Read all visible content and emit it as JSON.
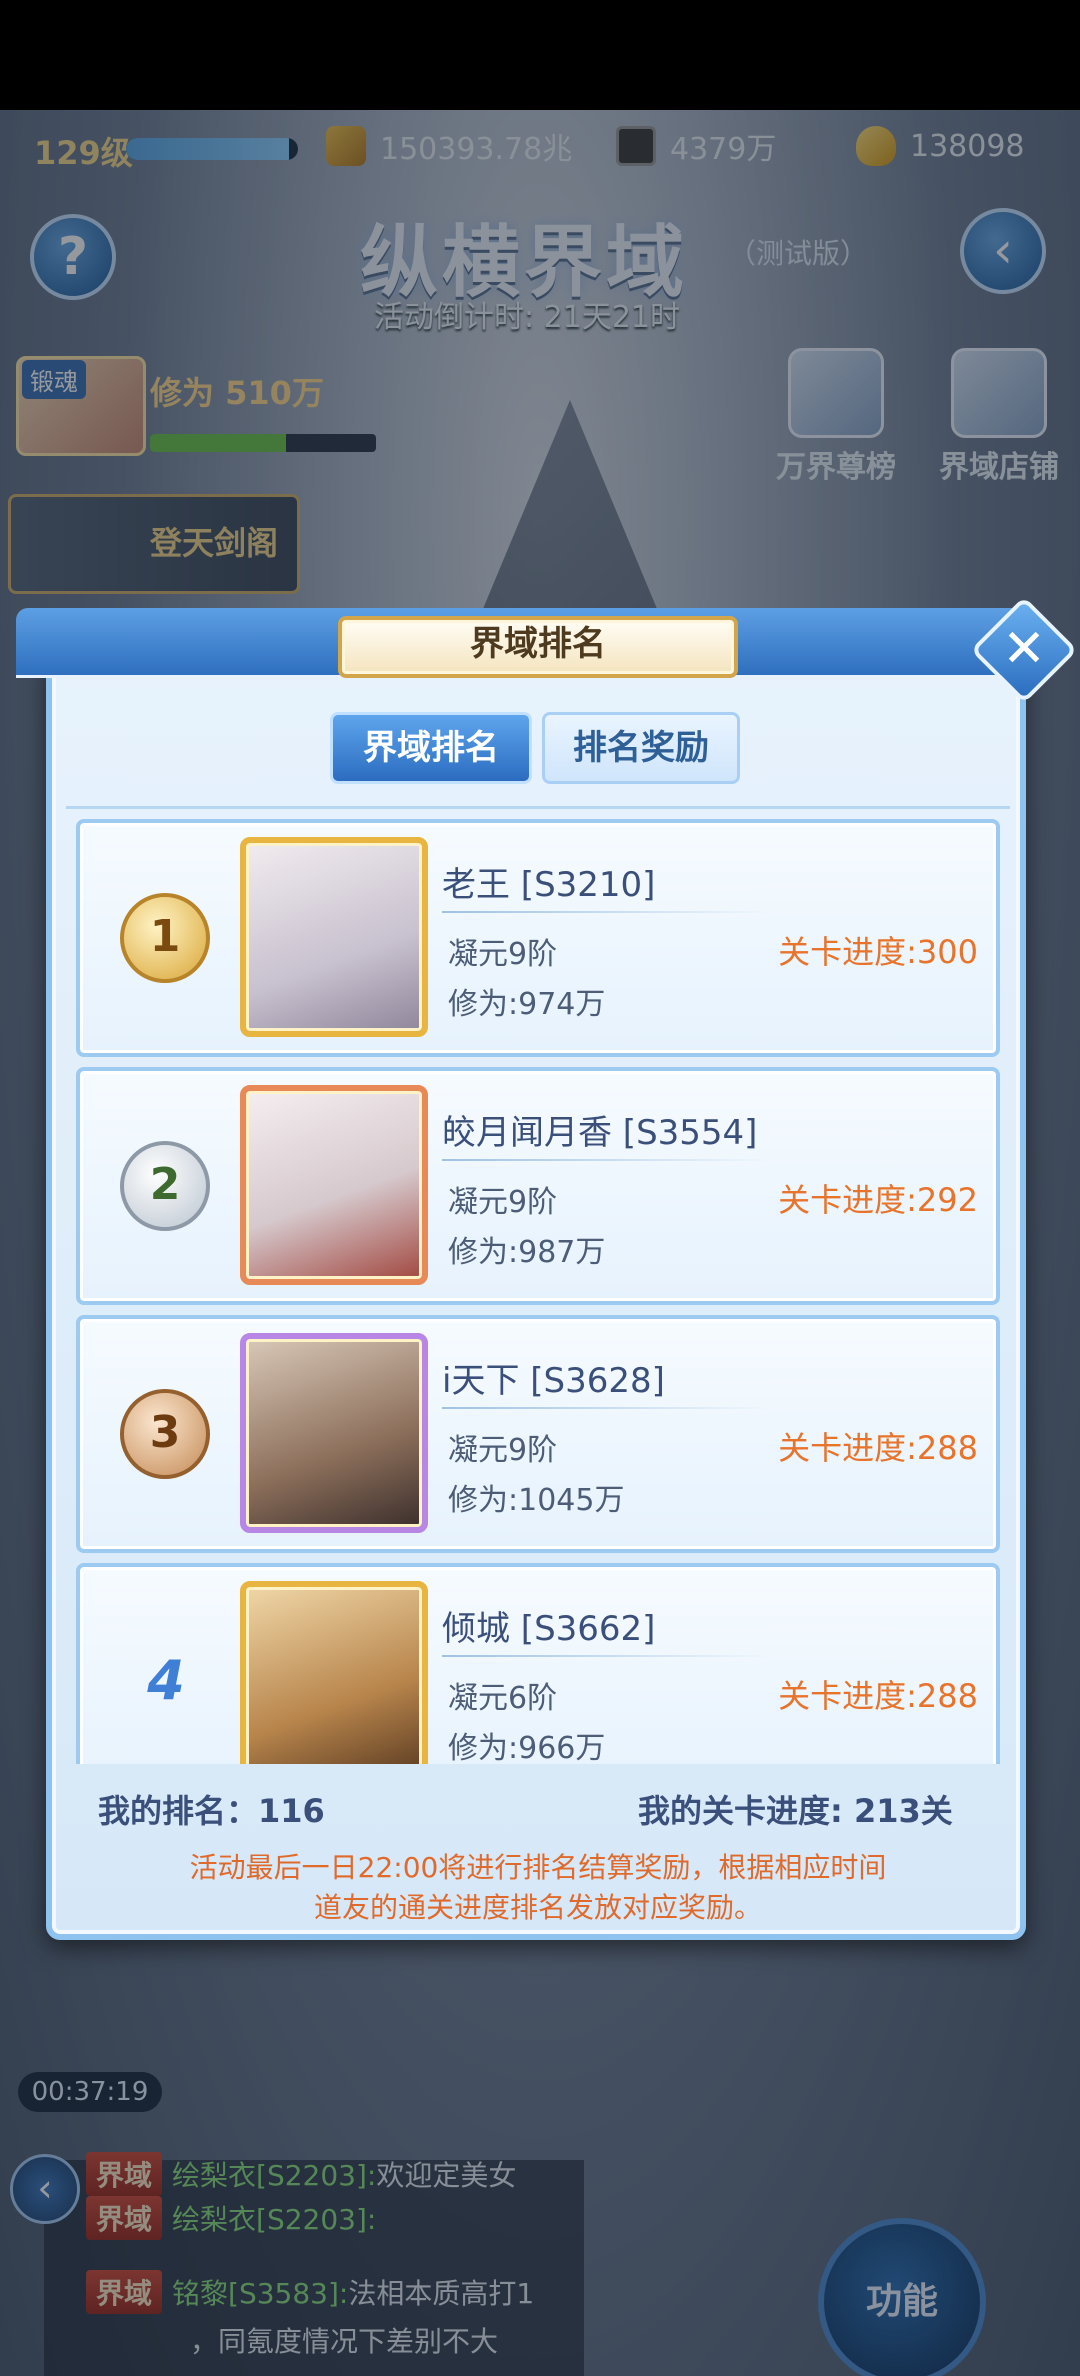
{
  "status": {
    "level": "129级",
    "exp_fraction": 0.95,
    "combat_power": "150393.78兆",
    "coins": "4379万",
    "gold": "138098"
  },
  "scene": {
    "title": "纵横界域",
    "version": "（测试版）",
    "countdown": "活动倒计时: 21天21时",
    "soul_tag": "锻魂",
    "cultivation": "修为 510万",
    "cultivation_fraction": 0.6,
    "pavilion": "登天剑阁",
    "rank_board": "万界尊榜",
    "shop": "界域店铺",
    "timer": "00:37:19",
    "function_button": "功能"
  },
  "chat": {
    "messages": [
      {
        "channel": "界域",
        "name": "绘梨衣[S2203]:",
        "text": "欢迎定美女"
      },
      {
        "channel": "界域",
        "name": "绘梨衣[S2203]:",
        "text": ""
      },
      {
        "channel": "界域",
        "name": "铭黎[S3583]:",
        "text": "法相本质高打1"
      },
      {
        "channel": "",
        "name": "",
        "text": "，同氪度情况下差别不大"
      }
    ]
  },
  "modal": {
    "title": "界域排名",
    "tabs": [
      {
        "label": "界域排名",
        "active": true
      },
      {
        "label": "排名奖励",
        "active": false
      }
    ],
    "rankings": [
      {
        "rank": "1",
        "name": "老王 [S3210]",
        "realm": "凝元9阶",
        "power": "修为:974万",
        "progress": "关卡进度:300"
      },
      {
        "rank": "2",
        "name": "皎月闻月香 [S3554]",
        "realm": "凝元9阶",
        "power": "修为:987万",
        "progress": "关卡进度:292"
      },
      {
        "rank": "3",
        "name": "i天下 [S3628]",
        "realm": "凝元9阶",
        "power": "修为:1045万",
        "progress": "关卡进度:288"
      },
      {
        "rank": "4",
        "name": "倾城 [S3662]",
        "realm": "凝元6阶",
        "power": "修为:966万",
        "progress": "关卡进度:288"
      }
    ],
    "my_rank": "我的排名：116",
    "my_progress": "我的关卡进度: 213关",
    "notice_line1": "活动最后一日22:00将进行排名结算奖励，根据相应时间",
    "notice_line2": "道友的通关进度排名发放对应奖励。",
    "close_symbol": "✕"
  }
}
